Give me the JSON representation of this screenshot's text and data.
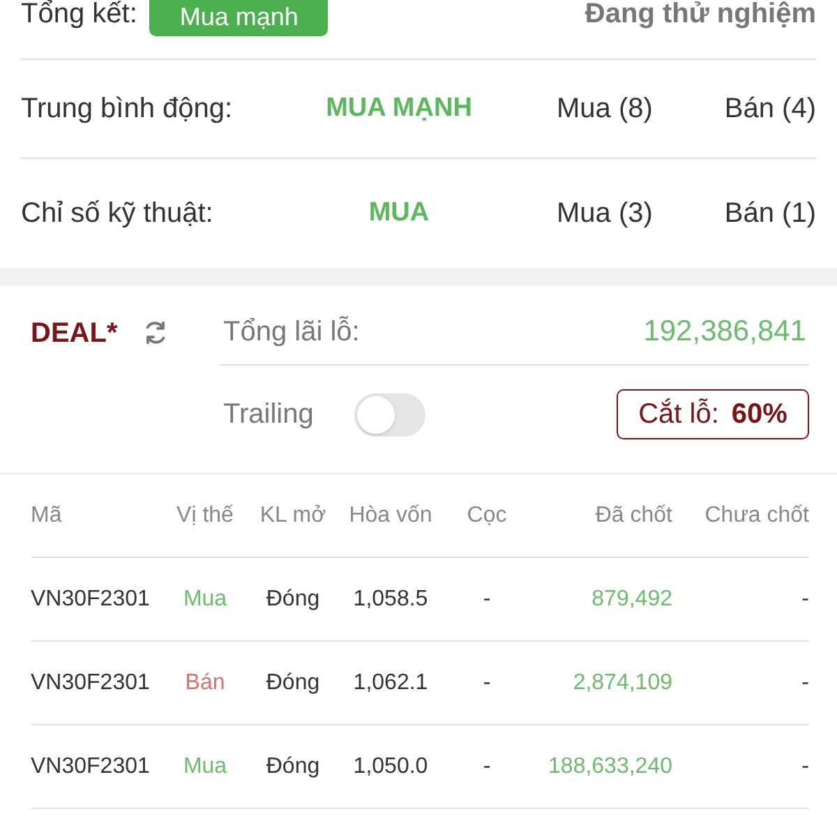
{
  "summary": {
    "label": "Tổng kết:",
    "badge": "Mua mạnh",
    "status": "Đang thử nghiệm"
  },
  "indicators": [
    {
      "label": "Trung bình động:",
      "signal": "MUA MẠNH",
      "buy": "Mua (8)",
      "sell": "Bán (4)"
    },
    {
      "label": "Chỉ số kỹ thuật:",
      "signal": "MUA",
      "buy": "Mua (3)",
      "sell": "Bán (1)"
    }
  ],
  "deal": {
    "title": "DEAL*",
    "total_label": "Tổng lãi lỗ:",
    "total_value": "192,386,841",
    "trailing": {
      "label": "Trailing",
      "on": false
    },
    "stop_loss": {
      "label": "Cắt lỗ:",
      "value": "60%"
    }
  },
  "table": {
    "columns": [
      "Mã",
      "Vị thế",
      "KL mở",
      "Hòa vốn",
      "Cọc",
      "Đã chốt",
      "Chưa chốt"
    ],
    "rows": [
      {
        "cells": [
          "VN30F2301",
          "Mua",
          "Đóng",
          "1,058.5",
          "-",
          "879,492",
          "-"
        ],
        "color": "#6dbb6d"
      },
      {
        "cells": [
          "VN30F2301",
          "Bán",
          "Đóng",
          "1,062.1",
          "-",
          "2,874,109",
          "-"
        ],
        "color": "#e07070"
      },
      {
        "cells": [
          "VN30F2301",
          "Mua",
          "Đóng",
          "1,050.0",
          "-",
          "188,633,240",
          "-"
        ],
        "color": "#6dbb6d"
      }
    ]
  }
}
